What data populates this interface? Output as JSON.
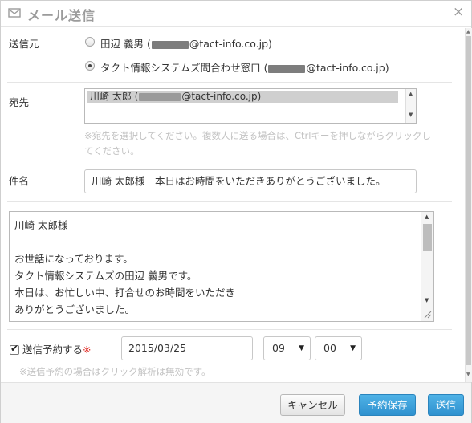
{
  "dialog": {
    "title": "メール送信",
    "close_label": "×"
  },
  "sender": {
    "label": "送信元",
    "options": [
      {
        "prefix": "田辺 義男 (",
        "suffix": "@tact-info.co.jp)",
        "selected": false
      },
      {
        "prefix": "タクト情報システムズ問合わせ窓口 (",
        "suffix": "@tact-info.co.jp)",
        "selected": true
      }
    ]
  },
  "recipient": {
    "label": "宛先",
    "selected_prefix": "川崎 太郎 (",
    "selected_suffix": "@tact-info.co.jp)",
    "hint_line1": "※宛先を選択してください。複数人に送る場合は、Ctrlキーを押しながらクリックし",
    "hint_line2": "てください。"
  },
  "subject": {
    "label": "件名",
    "value": "川崎 太郎様　本日はお時間をいただきありがとうございました。"
  },
  "body_text": {
    "lines": [
      "川崎 太郎様",
      "",
      "お世話になっております。",
      "タクト情報システムズの田辺 義男です。",
      "本日は、お忙しい中、打合せのお時間をいただき",
      "ありがとうございました。"
    ]
  },
  "schedule": {
    "checked": true,
    "label": "送信予約する",
    "required_mark": "※",
    "date": "2015/03/25",
    "hour": "09",
    "minute": "00",
    "note": "※送信予約の場合はクリック解析は無効です。"
  },
  "footer": {
    "cancel_label": "キャンセル",
    "save_label": "予約保存",
    "send_label": "送信"
  },
  "colors": {
    "primary_button": "#3a9fdb",
    "required": "#e0302a",
    "hint": "#c2c2c2"
  }
}
